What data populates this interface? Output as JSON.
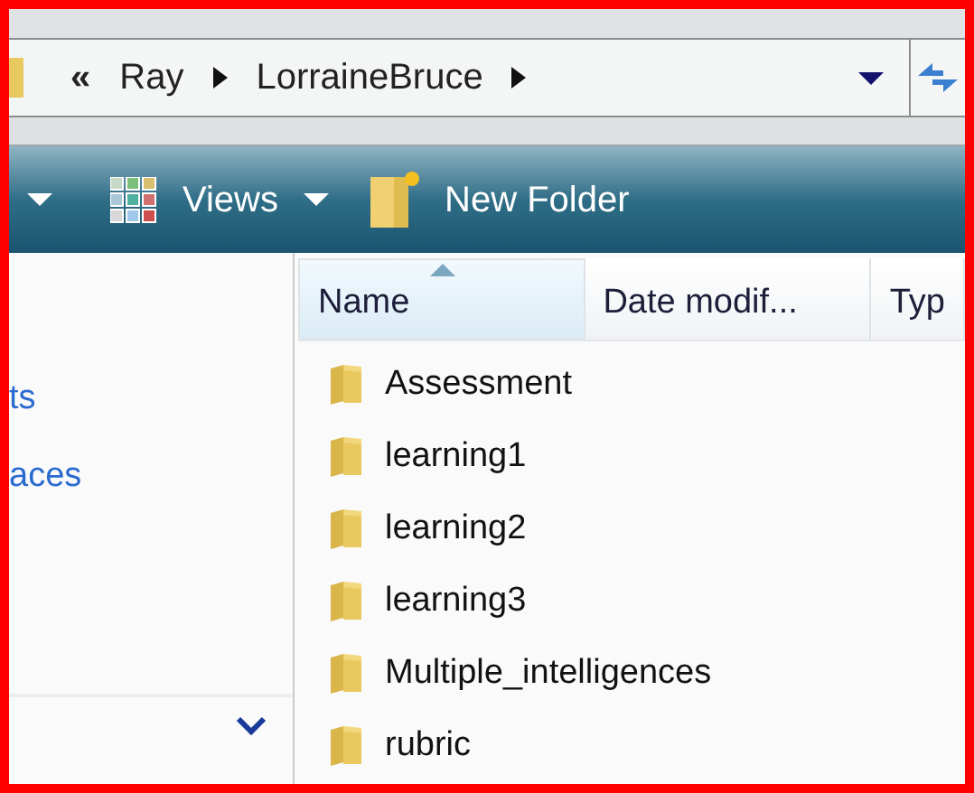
{
  "address_bar": {
    "overflow": "«",
    "crumbs": [
      "Ray",
      "LorraineBruce"
    ]
  },
  "toolbar": {
    "items": [
      {
        "kind": "dropdown"
      },
      {
        "kind": "views",
        "label": "Views"
      },
      {
        "kind": "dropdown"
      },
      {
        "kind": "new_folder",
        "label": "New Folder"
      }
    ]
  },
  "sidebar": {
    "items": [
      "ts",
      "aces"
    ]
  },
  "table": {
    "columns": [
      {
        "label": "Name",
        "selected": true
      },
      {
        "label": "Date modif...",
        "selected": false
      },
      {
        "label": "Typ",
        "selected": false
      }
    ],
    "rows": [
      "Assessment",
      "learning1",
      "learning2",
      "learning3",
      "Multiple_intelligences",
      "rubric"
    ]
  }
}
